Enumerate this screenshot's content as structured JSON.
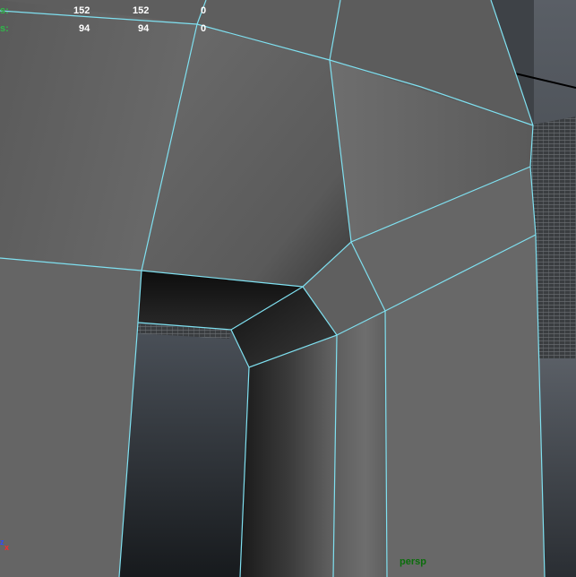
{
  "hud": {
    "rows": [
      {
        "label": "s:",
        "value1": "152",
        "value2": "152",
        "value3": "0"
      },
      {
        "label": "s:",
        "value1": "94",
        "value2": "94",
        "value3": "0"
      }
    ]
  },
  "viewport": {
    "camera_name": "persp",
    "axis_z_label": "z",
    "axis_x_label": "x",
    "wire_color": "#7fe0f0"
  }
}
